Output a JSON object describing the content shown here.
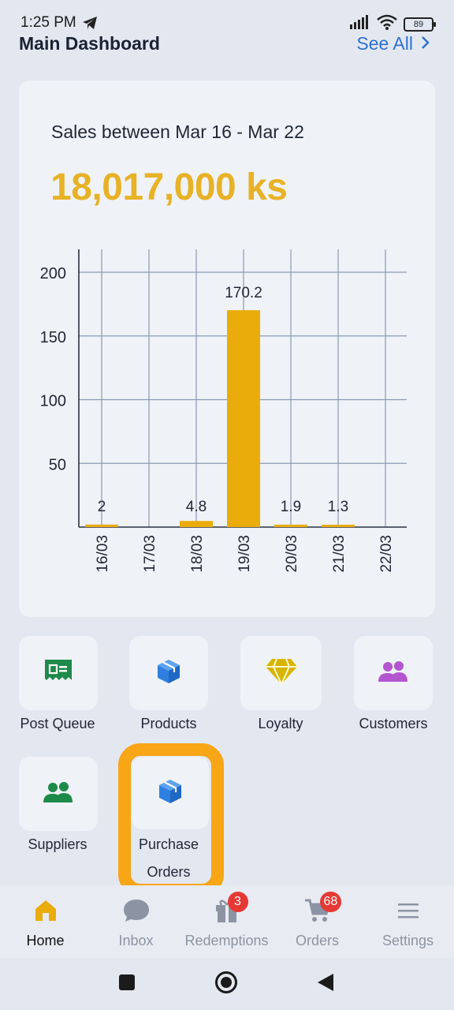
{
  "status_bar": {
    "time": "1:25 PM",
    "battery": "89"
  },
  "header": {
    "title": "Main Dashboard",
    "see_all": "See All"
  },
  "sales_card": {
    "heading": "Sales between Mar 16 - Mar 22",
    "total": "18,017,000 ks"
  },
  "chart_data": {
    "type": "bar",
    "categories": [
      "16/03",
      "17/03",
      "18/03",
      "19/03",
      "20/03",
      "21/03",
      "22/03"
    ],
    "values": [
      2,
      0,
      4.8,
      170.2,
      1.9,
      1.3,
      0
    ],
    "value_labels": [
      "2",
      "",
      "4.8",
      "170.2",
      "1.9",
      "1.3",
      ""
    ],
    "yticks": [
      50,
      100,
      150,
      200
    ],
    "ylim": [
      0,
      220
    ],
    "grid": true,
    "bar_color": "#eaac0b",
    "title": "",
    "xlabel": "",
    "ylabel": ""
  },
  "tiles": [
    {
      "label": "Post Queue",
      "icon": "receipt-icon",
      "color": "#1e8a4a"
    },
    {
      "label": "Products",
      "icon": "box-icon",
      "color": "#2f7fe0"
    },
    {
      "label": "Loyalty",
      "icon": "diamond-icon",
      "color": "#d8b400"
    },
    {
      "label": "Customers",
      "icon": "people-icon",
      "color": "#b455d0"
    },
    {
      "label": "Suppliers",
      "icon": "people-icon",
      "color": "#1e8a4a"
    },
    {
      "label": "Purchase\nOrders",
      "label_line1": "Purchase",
      "label_line2": "Orders",
      "icon": "box-icon",
      "color": "#2f7fe0"
    }
  ],
  "bottom_nav": [
    {
      "label": "Home",
      "icon": "home-icon",
      "active": true
    },
    {
      "label": "Inbox",
      "icon": "chat-icon"
    },
    {
      "label": "Redemptions",
      "icon": "gift-icon",
      "badge": "3"
    },
    {
      "label": "Orders",
      "icon": "cart-icon",
      "badge": "68"
    },
    {
      "label": "Settings",
      "icon": "menu-icon"
    }
  ],
  "colors": {
    "accent": "#e8b226",
    "highlight": "#f8a516",
    "link": "#2f6fd1",
    "badge": "#e53935"
  }
}
